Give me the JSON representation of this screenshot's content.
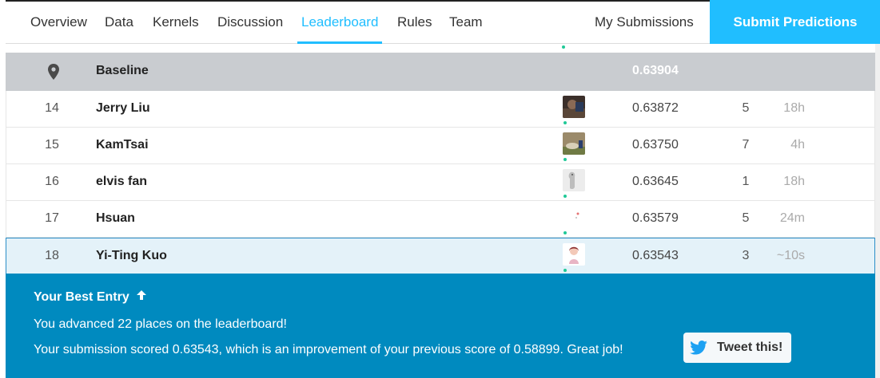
{
  "nav": {
    "tabs": [
      {
        "label": "Overview"
      },
      {
        "label": "Data"
      },
      {
        "label": "Kernels"
      },
      {
        "label": "Discussion"
      },
      {
        "label": "Leaderboard"
      },
      {
        "label": "Rules"
      },
      {
        "label": "Team"
      }
    ],
    "active_tab": "Leaderboard",
    "my_submissions": "My Submissions",
    "submit_button": "Submit Predictions",
    "accent_color": "#20beff"
  },
  "leaderboard": {
    "baseline": {
      "name": "Baseline",
      "score": "0.63904",
      "icon": "location-pin-icon"
    },
    "rows": [
      {
        "rank": "14",
        "name": "Jerry Liu",
        "score": "0.63872",
        "entries": "5",
        "last": "18h"
      },
      {
        "rank": "15",
        "name": "KamTsai",
        "score": "0.63750",
        "entries": "7",
        "last": "4h"
      },
      {
        "rank": "16",
        "name": "elvis fan",
        "score": "0.63645",
        "entries": "1",
        "last": "18h"
      },
      {
        "rank": "17",
        "name": "Hsuan",
        "score": "0.63579",
        "entries": "5",
        "last": "24m"
      },
      {
        "rank": "18",
        "name": "Yi-Ting Kuo",
        "score": "0.63543",
        "entries": "3",
        "last": "~10s"
      }
    ]
  },
  "banner": {
    "title": "Your Best Entry",
    "title_icon": "arrow-up-icon",
    "advanced": "You advanced 22 places on the leaderboard!",
    "scored": "Your submission scored 0.63543, which is an improvement of your previous score of 0.58899. Great job!",
    "tweet_label": "Tweet this!",
    "tweet_icon": "twitter-bird-icon",
    "background_color": "#008abf"
  }
}
